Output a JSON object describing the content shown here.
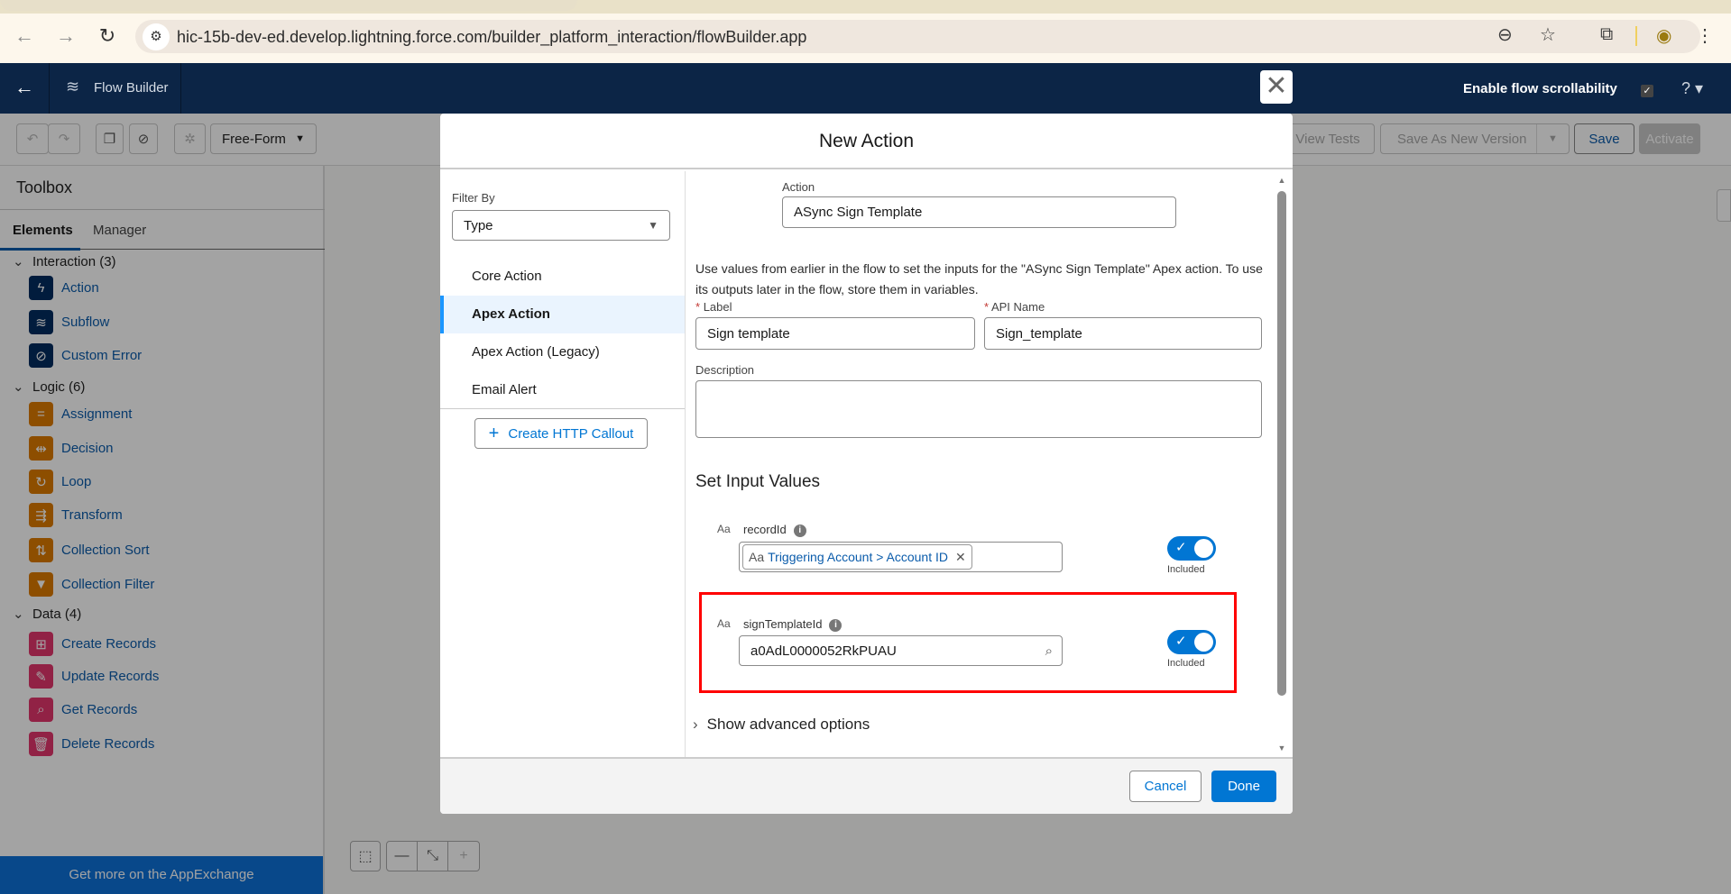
{
  "browser": {
    "url": "hic-15b-dev-ed.develop.lightning.force.com/builder_platform_interaction/flowBuilder.app",
    "icons": [
      "back-icon",
      "forward-icon",
      "reload-icon",
      "site-info-icon",
      "zoom-out-icon",
      "star-icon",
      "extensions-icon",
      "profile-icon",
      "menu-icon"
    ]
  },
  "navbar": {
    "title": "Flow Builder",
    "scrollability_label": "Enable flow scrollability",
    "scrollability_checked": true,
    "help": "?"
  },
  "toolbar": {
    "layout_select": "Free-Form",
    "view_tests": "View Tests",
    "save_as_new_version": "Save As New Version",
    "save": "Save",
    "activate": "Activate"
  },
  "sidebar": {
    "title": "Toolbox",
    "tabs": [
      "Elements",
      "Manager"
    ],
    "groups": [
      {
        "label": "Interaction (3)",
        "items": [
          "Action",
          "Subflow",
          "Custom Error"
        ]
      },
      {
        "label": "Logic (6)",
        "items": [
          "Assignment",
          "Decision",
          "Loop",
          "Transform",
          "Collection Sort",
          "Collection Filter"
        ]
      },
      {
        "label": "Data (4)",
        "items": [
          "Create Records",
          "Update Records",
          "Get Records",
          "Delete Records"
        ]
      }
    ],
    "footer": "Get more on the AppExchange"
  },
  "modal": {
    "title": "New Action",
    "filter_label": "Filter By",
    "filter_value": "Type",
    "categories": [
      "Core Action",
      "Apex Action",
      "Apex Action (Legacy)",
      "Email Alert"
    ],
    "selected_category": "Apex Action",
    "create_http_callout": "Create HTTP Callout",
    "action_label": "Action",
    "action_value": "ASync Sign Template",
    "description_text": "Use values from earlier in the flow to set the inputs for the \"ASync Sign Template\" Apex action. To use its outputs later in the flow, store them in variables.",
    "label_label": "Label",
    "label_value": "Sign template",
    "api_name_label": "API Name",
    "api_name_value": "Sign_template",
    "description_label": "Description",
    "description_value": "",
    "set_input_values": "Set Input Values",
    "inputs": [
      {
        "name": "recordId",
        "type_icon": "Aa",
        "value": "Triggering Account > Account ID",
        "included_label": "Included",
        "included": true
      },
      {
        "name": "signTemplateId",
        "type_icon": "Aa",
        "value": "a0AdL0000052RkPUAU",
        "included_label": "Included",
        "included": true
      }
    ],
    "advanced": "Show advanced options",
    "cancel": "Cancel",
    "done": "Done"
  },
  "colors": {
    "brand": "#0176d3",
    "nav": "#0c2546",
    "highlight": "#ff0000"
  }
}
